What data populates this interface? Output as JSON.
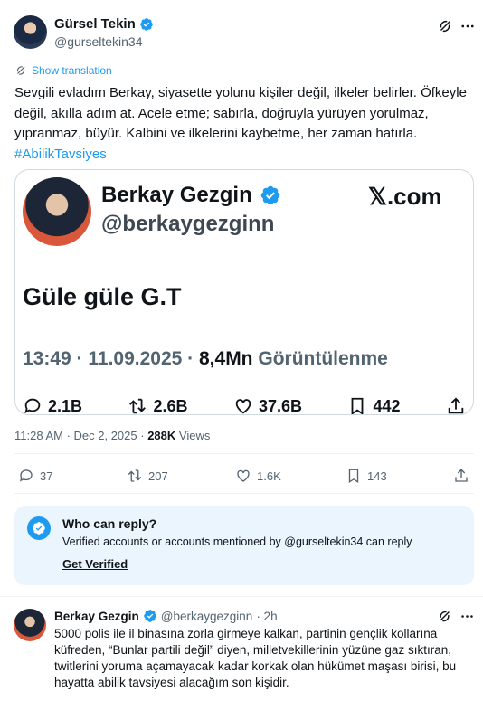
{
  "colors": {
    "accent": "#1d9bf0",
    "muted": "#536471",
    "reply_box_bg": "#eaf5fd"
  },
  "author": {
    "name": "Gürsel Tekin",
    "handle": "@gurseltekin34"
  },
  "translation": {
    "label": "Show translation"
  },
  "tweet": {
    "text": "Sevgili evladım Berkay, siyasette yolunu kişiler değil, ilkeler belirler. Öfkeyle değil, akılla adım at. Acele etme; sabırla, doğruyla yürüyen yorulmaz, yıpranmaz, büyür. Kalbini ve ilkelerini kaybetme, her zaman hatırla.",
    "hashtag": "#AbilikTavsiyes"
  },
  "embed": {
    "name": "Berkay Gezgin",
    "handle": "@berkaygezginn",
    "brand": "𝕏.com",
    "text": "Güle güle G.T",
    "meta_time": "13:49 · 11.09.2025 ·",
    "meta_views": "8,4Mn",
    "meta_views_label": "Görüntülenme",
    "stats": {
      "replies": "2.1B",
      "reposts": "2.6B",
      "likes": "37.6B",
      "bookmarks": "442"
    }
  },
  "meta": {
    "datetime": "11:28 AM · Dec 2, 2025 ·",
    "views_count": "288K",
    "views_label": "Views"
  },
  "actions": {
    "replies": "37",
    "reposts": "207",
    "likes": "1.6K",
    "bookmarks": "143"
  },
  "who_can_reply": {
    "title": "Who can reply?",
    "description": "Verified accounts or accounts mentioned by @gurseltekin34 can reply",
    "cta": "Get Verified"
  },
  "reply": {
    "name": "Berkay Gezgin",
    "handle": "@berkaygezginn",
    "time": "· 2h",
    "text": "5000 polis ile il binasına zorla girmeye kalkan, partinin gençlik kollarına küfreden, “Bunlar partili değil” diyen, milletvekillerinin yüzüne gaz sıktıran, twitlerini yoruma açamayacak kadar korkak olan hükümet maşası birisi, bu hayatta abilik tavsiyesi alacağım son kişidir."
  }
}
